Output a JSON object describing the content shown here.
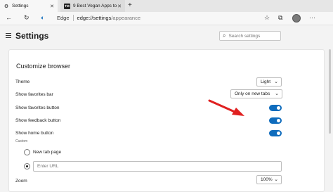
{
  "tabs": [
    {
      "title": "Settings",
      "icon": "gear-icon"
    },
    {
      "title": "9 Best Vegan Apps to Create Pla",
      "icon": "tm-favicon-icon",
      "favicon_text": "TM"
    }
  ],
  "toolbar": {
    "edge_label": "Edge",
    "url_host": "edge://settings",
    "url_path": "/appearance"
  },
  "header": {
    "title": "Settings",
    "search_placeholder": "Search settings"
  },
  "customize": {
    "title": "Customize browser",
    "theme": {
      "label": "Theme",
      "value": "Light"
    },
    "favorites_bar": {
      "label": "Show favorites bar",
      "value": "Only on new tabs"
    },
    "favorites_button": {
      "label": "Show favorites button",
      "on": true
    },
    "feedback_button": {
      "label": "Show feedback button",
      "on": true
    },
    "home_button": {
      "label": "Show home button",
      "on": true
    },
    "custom_label": "Custom",
    "new_tab_option": "New tab page",
    "url_placeholder": "Enter URL",
    "zoom": {
      "label": "Zoom",
      "value": "100%"
    }
  },
  "colors": {
    "accent": "#0f6cbd",
    "annotation_arrow": "#e02020"
  }
}
